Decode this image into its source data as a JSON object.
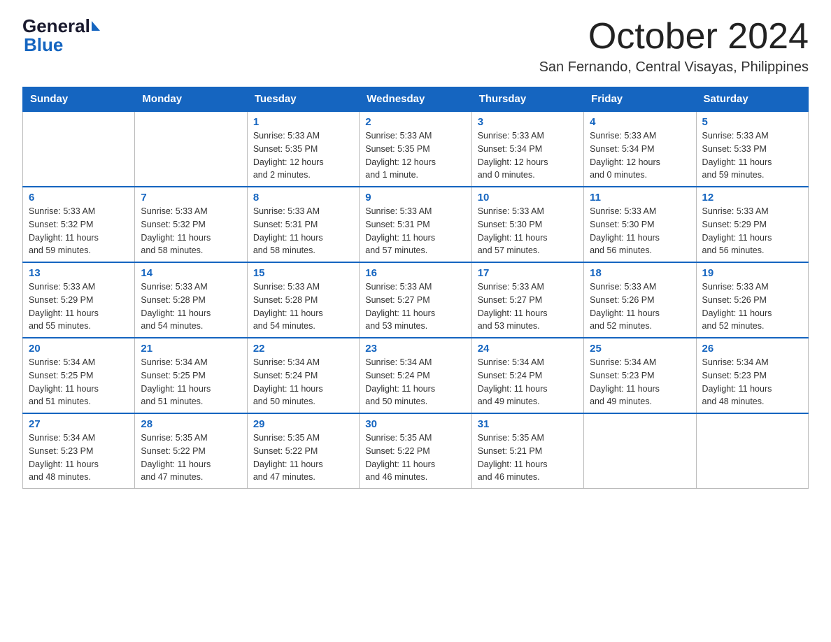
{
  "logo": {
    "general_text": "General",
    "blue_text": "Blue"
  },
  "title": {
    "month_year": "October 2024",
    "location": "San Fernando, Central Visayas, Philippines"
  },
  "headers": [
    "Sunday",
    "Monday",
    "Tuesday",
    "Wednesday",
    "Thursday",
    "Friday",
    "Saturday"
  ],
  "weeks": [
    [
      {
        "day": "",
        "info": ""
      },
      {
        "day": "",
        "info": ""
      },
      {
        "day": "1",
        "info": "Sunrise: 5:33 AM\nSunset: 5:35 PM\nDaylight: 12 hours\nand 2 minutes."
      },
      {
        "day": "2",
        "info": "Sunrise: 5:33 AM\nSunset: 5:35 PM\nDaylight: 12 hours\nand 1 minute."
      },
      {
        "day": "3",
        "info": "Sunrise: 5:33 AM\nSunset: 5:34 PM\nDaylight: 12 hours\nand 0 minutes."
      },
      {
        "day": "4",
        "info": "Sunrise: 5:33 AM\nSunset: 5:34 PM\nDaylight: 12 hours\nand 0 minutes."
      },
      {
        "day": "5",
        "info": "Sunrise: 5:33 AM\nSunset: 5:33 PM\nDaylight: 11 hours\nand 59 minutes."
      }
    ],
    [
      {
        "day": "6",
        "info": "Sunrise: 5:33 AM\nSunset: 5:32 PM\nDaylight: 11 hours\nand 59 minutes."
      },
      {
        "day": "7",
        "info": "Sunrise: 5:33 AM\nSunset: 5:32 PM\nDaylight: 11 hours\nand 58 minutes."
      },
      {
        "day": "8",
        "info": "Sunrise: 5:33 AM\nSunset: 5:31 PM\nDaylight: 11 hours\nand 58 minutes."
      },
      {
        "day": "9",
        "info": "Sunrise: 5:33 AM\nSunset: 5:31 PM\nDaylight: 11 hours\nand 57 minutes."
      },
      {
        "day": "10",
        "info": "Sunrise: 5:33 AM\nSunset: 5:30 PM\nDaylight: 11 hours\nand 57 minutes."
      },
      {
        "day": "11",
        "info": "Sunrise: 5:33 AM\nSunset: 5:30 PM\nDaylight: 11 hours\nand 56 minutes."
      },
      {
        "day": "12",
        "info": "Sunrise: 5:33 AM\nSunset: 5:29 PM\nDaylight: 11 hours\nand 56 minutes."
      }
    ],
    [
      {
        "day": "13",
        "info": "Sunrise: 5:33 AM\nSunset: 5:29 PM\nDaylight: 11 hours\nand 55 minutes."
      },
      {
        "day": "14",
        "info": "Sunrise: 5:33 AM\nSunset: 5:28 PM\nDaylight: 11 hours\nand 54 minutes."
      },
      {
        "day": "15",
        "info": "Sunrise: 5:33 AM\nSunset: 5:28 PM\nDaylight: 11 hours\nand 54 minutes."
      },
      {
        "day": "16",
        "info": "Sunrise: 5:33 AM\nSunset: 5:27 PM\nDaylight: 11 hours\nand 53 minutes."
      },
      {
        "day": "17",
        "info": "Sunrise: 5:33 AM\nSunset: 5:27 PM\nDaylight: 11 hours\nand 53 minutes."
      },
      {
        "day": "18",
        "info": "Sunrise: 5:33 AM\nSunset: 5:26 PM\nDaylight: 11 hours\nand 52 minutes."
      },
      {
        "day": "19",
        "info": "Sunrise: 5:33 AM\nSunset: 5:26 PM\nDaylight: 11 hours\nand 52 minutes."
      }
    ],
    [
      {
        "day": "20",
        "info": "Sunrise: 5:34 AM\nSunset: 5:25 PM\nDaylight: 11 hours\nand 51 minutes."
      },
      {
        "day": "21",
        "info": "Sunrise: 5:34 AM\nSunset: 5:25 PM\nDaylight: 11 hours\nand 51 minutes."
      },
      {
        "day": "22",
        "info": "Sunrise: 5:34 AM\nSunset: 5:24 PM\nDaylight: 11 hours\nand 50 minutes."
      },
      {
        "day": "23",
        "info": "Sunrise: 5:34 AM\nSunset: 5:24 PM\nDaylight: 11 hours\nand 50 minutes."
      },
      {
        "day": "24",
        "info": "Sunrise: 5:34 AM\nSunset: 5:24 PM\nDaylight: 11 hours\nand 49 minutes."
      },
      {
        "day": "25",
        "info": "Sunrise: 5:34 AM\nSunset: 5:23 PM\nDaylight: 11 hours\nand 49 minutes."
      },
      {
        "day": "26",
        "info": "Sunrise: 5:34 AM\nSunset: 5:23 PM\nDaylight: 11 hours\nand 48 minutes."
      }
    ],
    [
      {
        "day": "27",
        "info": "Sunrise: 5:34 AM\nSunset: 5:23 PM\nDaylight: 11 hours\nand 48 minutes."
      },
      {
        "day": "28",
        "info": "Sunrise: 5:35 AM\nSunset: 5:22 PM\nDaylight: 11 hours\nand 47 minutes."
      },
      {
        "day": "29",
        "info": "Sunrise: 5:35 AM\nSunset: 5:22 PM\nDaylight: 11 hours\nand 47 minutes."
      },
      {
        "day": "30",
        "info": "Sunrise: 5:35 AM\nSunset: 5:22 PM\nDaylight: 11 hours\nand 46 minutes."
      },
      {
        "day": "31",
        "info": "Sunrise: 5:35 AM\nSunset: 5:21 PM\nDaylight: 11 hours\nand 46 minutes."
      },
      {
        "day": "",
        "info": ""
      },
      {
        "day": "",
        "info": ""
      }
    ]
  ]
}
